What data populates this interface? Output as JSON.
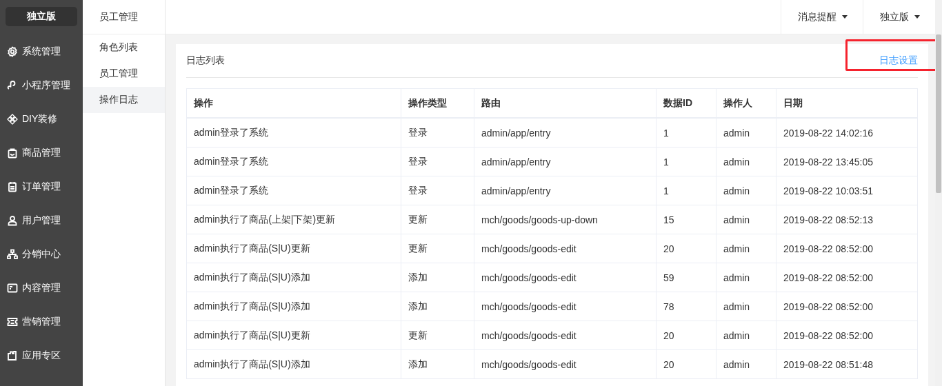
{
  "sidebar": {
    "badge": "独立版",
    "items": [
      {
        "label": "系统管理",
        "selected": false
      },
      {
        "label": "小程序管理",
        "selected": false
      },
      {
        "label": "DIY装修",
        "selected": false
      },
      {
        "label": "商品管理",
        "selected": false
      },
      {
        "label": "订单管理",
        "selected": false
      },
      {
        "label": "用户管理",
        "selected": false
      },
      {
        "label": "分销中心",
        "selected": false
      },
      {
        "label": "内容管理",
        "selected": false
      },
      {
        "label": "营销管理",
        "selected": false
      },
      {
        "label": "应用专区",
        "selected": false
      }
    ]
  },
  "submenu": {
    "title": "员工管理",
    "items": [
      {
        "label": "角色列表",
        "selected": false
      },
      {
        "label": "员工管理",
        "selected": false
      },
      {
        "label": "操作日志",
        "selected": true
      }
    ]
  },
  "header": {
    "menus": [
      "消息提醒",
      "独立版"
    ]
  },
  "card": {
    "title": "日志列表",
    "action": "日志设置",
    "table": {
      "columns": [
        "操作",
        "操作类型",
        "路由",
        "数据ID",
        "操作人",
        "日期"
      ],
      "rows": [
        [
          "admin登录了系统",
          "登录",
          "admin/app/entry",
          "1",
          "admin",
          "2019-08-22 14:02:16"
        ],
        [
          "admin登录了系统",
          "登录",
          "admin/app/entry",
          "1",
          "admin",
          "2019-08-22 13:45:05"
        ],
        [
          "admin登录了系统",
          "登录",
          "admin/app/entry",
          "1",
          "admin",
          "2019-08-22 10:03:51"
        ],
        [
          "admin执行了商品(上架|下架)更新",
          "更新",
          "mch/goods/goods-up-down",
          "15",
          "admin",
          "2019-08-22 08:52:13"
        ],
        [
          "admin执行了商品(S|U)更新",
          "更新",
          "mch/goods/goods-edit",
          "20",
          "admin",
          "2019-08-22 08:52:00"
        ],
        [
          "admin执行了商品(S|U)添加",
          "添加",
          "mch/goods/goods-edit",
          "59",
          "admin",
          "2019-08-22 08:52:00"
        ],
        [
          "admin执行了商品(S|U)添加",
          "添加",
          "mch/goods/goods-edit",
          "78",
          "admin",
          "2019-08-22 08:52:00"
        ],
        [
          "admin执行了商品(S|U)更新",
          "更新",
          "mch/goods/goods-edit",
          "20",
          "admin",
          "2019-08-22 08:52:00"
        ],
        [
          "admin执行了商品(S|U)添加",
          "添加",
          "mch/goods/goods-edit",
          "20",
          "admin",
          "2019-08-22 08:51:48"
        ]
      ]
    }
  }
}
